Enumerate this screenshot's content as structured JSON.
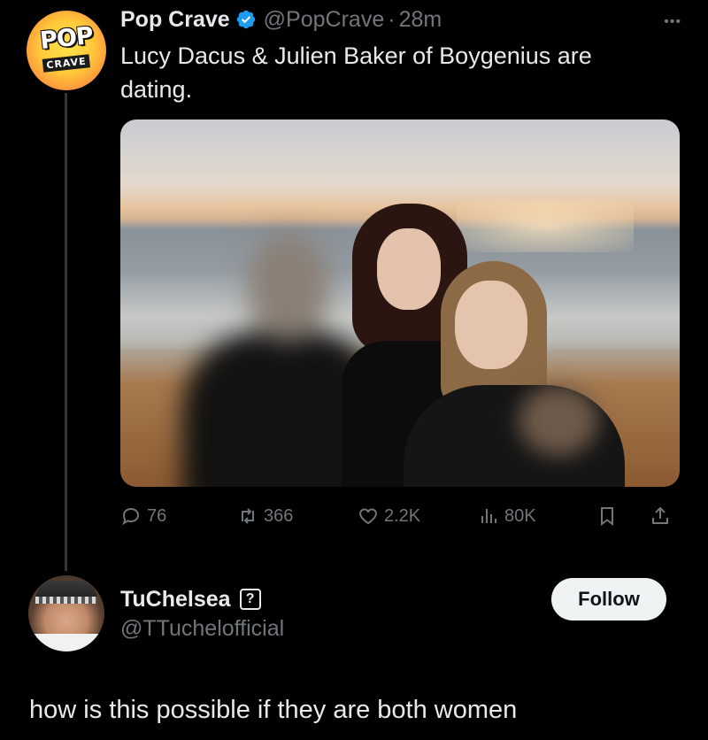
{
  "tweet": {
    "author": {
      "display_name": "Pop Crave",
      "handle": "@PopCrave",
      "separator": "·",
      "time": "28m",
      "verified": true,
      "avatar": {
        "logo_text": "POP",
        "logo_sub": "CRAVE"
      }
    },
    "text": "Lucy Dacus & Julien Baker of Boygenius are dating.",
    "media": {
      "description_icon": "photo"
    },
    "actions": {
      "replies": "76",
      "reposts": "366",
      "likes": "2.2K",
      "views": "80K"
    }
  },
  "reply": {
    "display_name": "TuChelsea",
    "badge": "?",
    "handle": "@TTuchelofficial",
    "follow_label": "Follow",
    "text": "how is this possible if they are both women"
  },
  "colors": {
    "background": "#000000",
    "text": "#e7e9ea",
    "muted": "#71767b",
    "verified": "#1d9bf0",
    "follow_bg": "#eff3f4"
  }
}
